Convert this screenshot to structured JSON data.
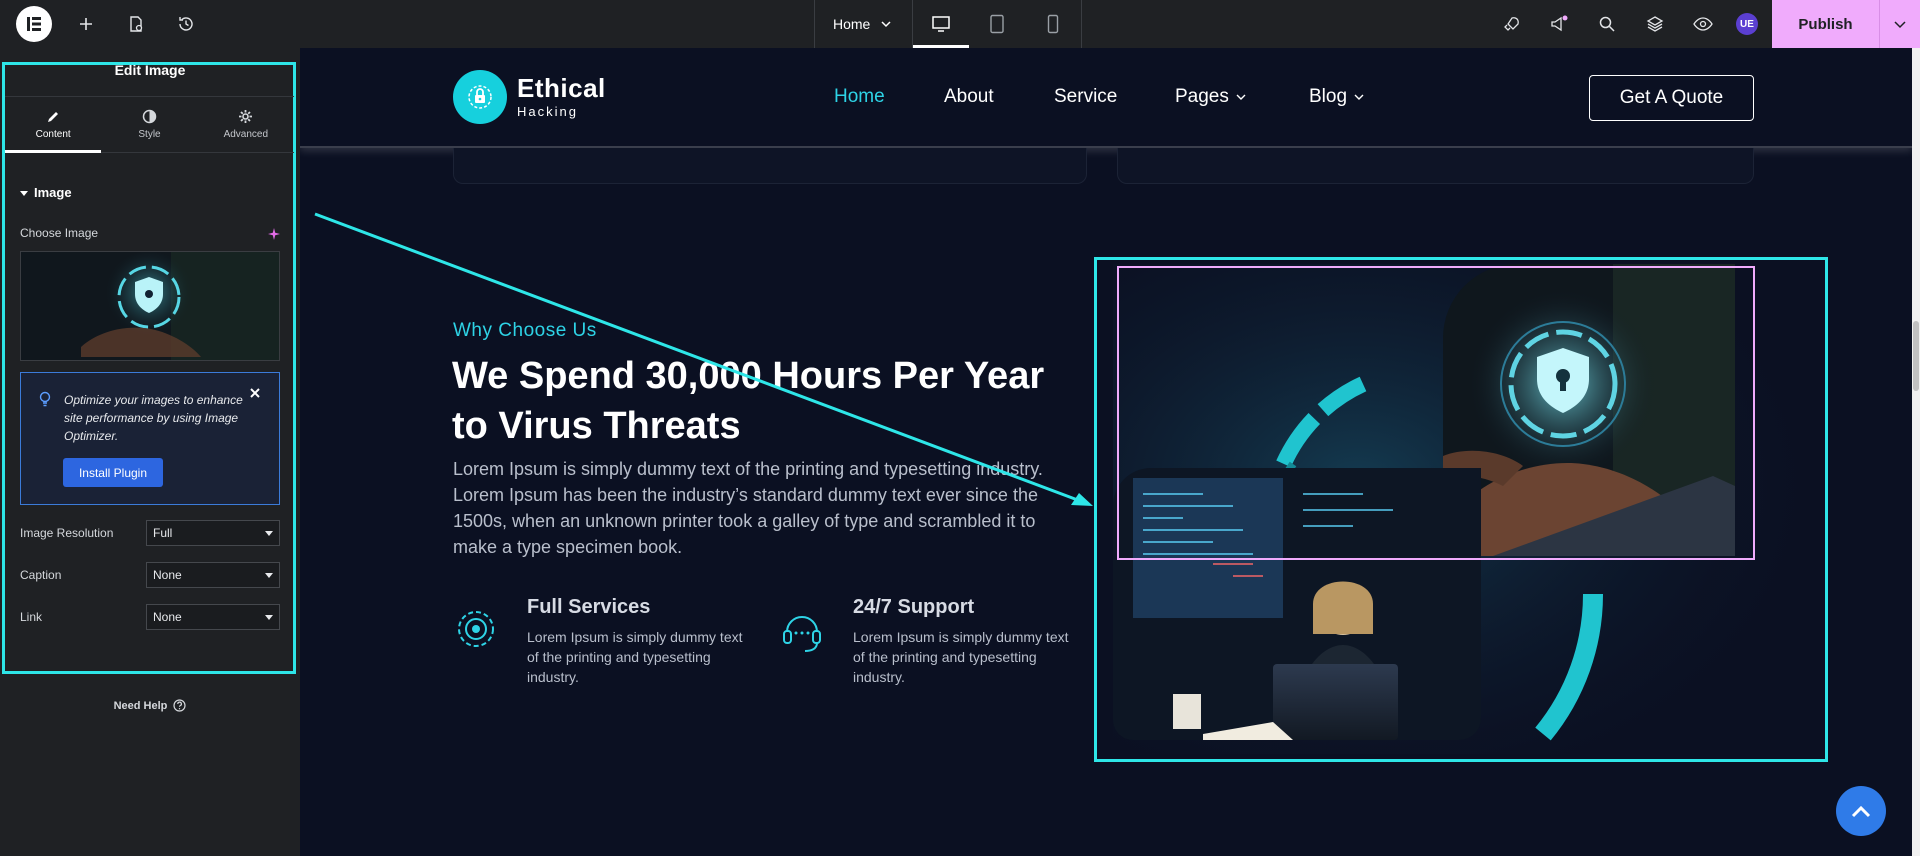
{
  "topbar": {
    "page_selector": "Home",
    "avatar_initials": "UE",
    "publish_label": "Publish",
    "accent_color": "#f0abfc"
  },
  "panel": {
    "title": "Edit Image",
    "tabs": [
      {
        "label": "Content",
        "icon": "pencil-icon"
      },
      {
        "label": "Style",
        "icon": "contrast-icon"
      },
      {
        "label": "Advanced",
        "icon": "gear-icon"
      }
    ],
    "section_title": "Image",
    "choose_image_label": "Choose Image",
    "notice": {
      "text": "Optimize your images to enhance site performance by using Image Optimizer.",
      "button": "Install Plugin"
    },
    "controls": [
      {
        "label": "Image Resolution",
        "value": "Full"
      },
      {
        "label": "Caption",
        "value": "None"
      },
      {
        "label": "Link",
        "value": "None"
      }
    ],
    "need_help": "Need Help"
  },
  "site": {
    "brand_name": "Ethical",
    "brand_sub": "Hacking",
    "nav": [
      {
        "label": "Home",
        "active": true,
        "dropdown": false
      },
      {
        "label": "About",
        "active": false,
        "dropdown": false
      },
      {
        "label": "Service",
        "active": false,
        "dropdown": false
      },
      {
        "label": "Pages",
        "active": false,
        "dropdown": true
      },
      {
        "label": "Blog",
        "active": false,
        "dropdown": true
      }
    ],
    "quote_button": "Get A Quote",
    "eyebrow": "Why Choose Us",
    "headline": "We Spend 30,000 Hours Per Year to Virus Threats",
    "paragraph": "Lorem Ipsum is simply dummy text of the printing and typesetting industry. Lorem Ipsum has been the industry’s standard dummy text ever since the 1500s, when an unknown printer took a galley of type and scrambled it to make a type specimen book.",
    "features": [
      {
        "title": "Full Services",
        "desc": "Lorem Ipsum is simply dummy text of the printing and typesetting industry.",
        "icon": "gear-chip-icon"
      },
      {
        "title": "24/7 Support",
        "desc": "Lorem Ipsum is simply dummy text of the printing and typesetting industry.",
        "icon": "headset-icon"
      }
    ],
    "accent_color": "#2ed3e6",
    "highlight_color": "#2ee6e8"
  }
}
